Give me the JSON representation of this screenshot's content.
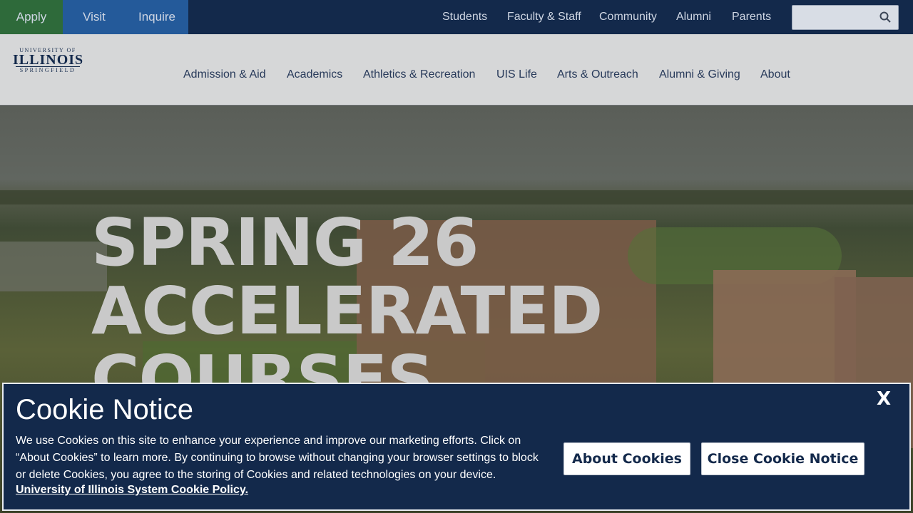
{
  "quicklinks": {
    "apply": "Apply",
    "visit": "Visit",
    "inquire": "Inquire"
  },
  "audience": [
    "Students",
    "Faculty & Staff",
    "Community",
    "Alumni",
    "Parents"
  ],
  "search": {
    "placeholder": "",
    "icon": "search-icon"
  },
  "logo": {
    "line1": "UNIVERSITY OF",
    "line2": "ILLINOIS",
    "line3": "SPRINGFIELD"
  },
  "nav": [
    "Admission & Aid",
    "Academics",
    "Athletics & Recreation",
    "UIS Life",
    "Arts & Outreach",
    "Alumni & Giving",
    "About"
  ],
  "hero": {
    "line1": "SPRING 26",
    "line2": "ACCELERATED",
    "line3": "COURSES"
  },
  "cookie": {
    "title": "Cookie Notice",
    "body": "We use Cookies on this site to enhance your experience and improve our marketing efforts. Click on “About Cookies” to learn more. By continuing to browse without changing your browser settings to block or delete Cookies, you agree to the storing of Cookies and related technologies on your device.",
    "policy_link": "University of Illinois System Cookie Policy.",
    "about_button": "About Cookies",
    "close_button": "Close Cookie Notice",
    "close_x": "X"
  },
  "colors": {
    "navy": "#13294b",
    "apply_green": "#2e6a3a",
    "visit_blue": "#245a9a"
  }
}
